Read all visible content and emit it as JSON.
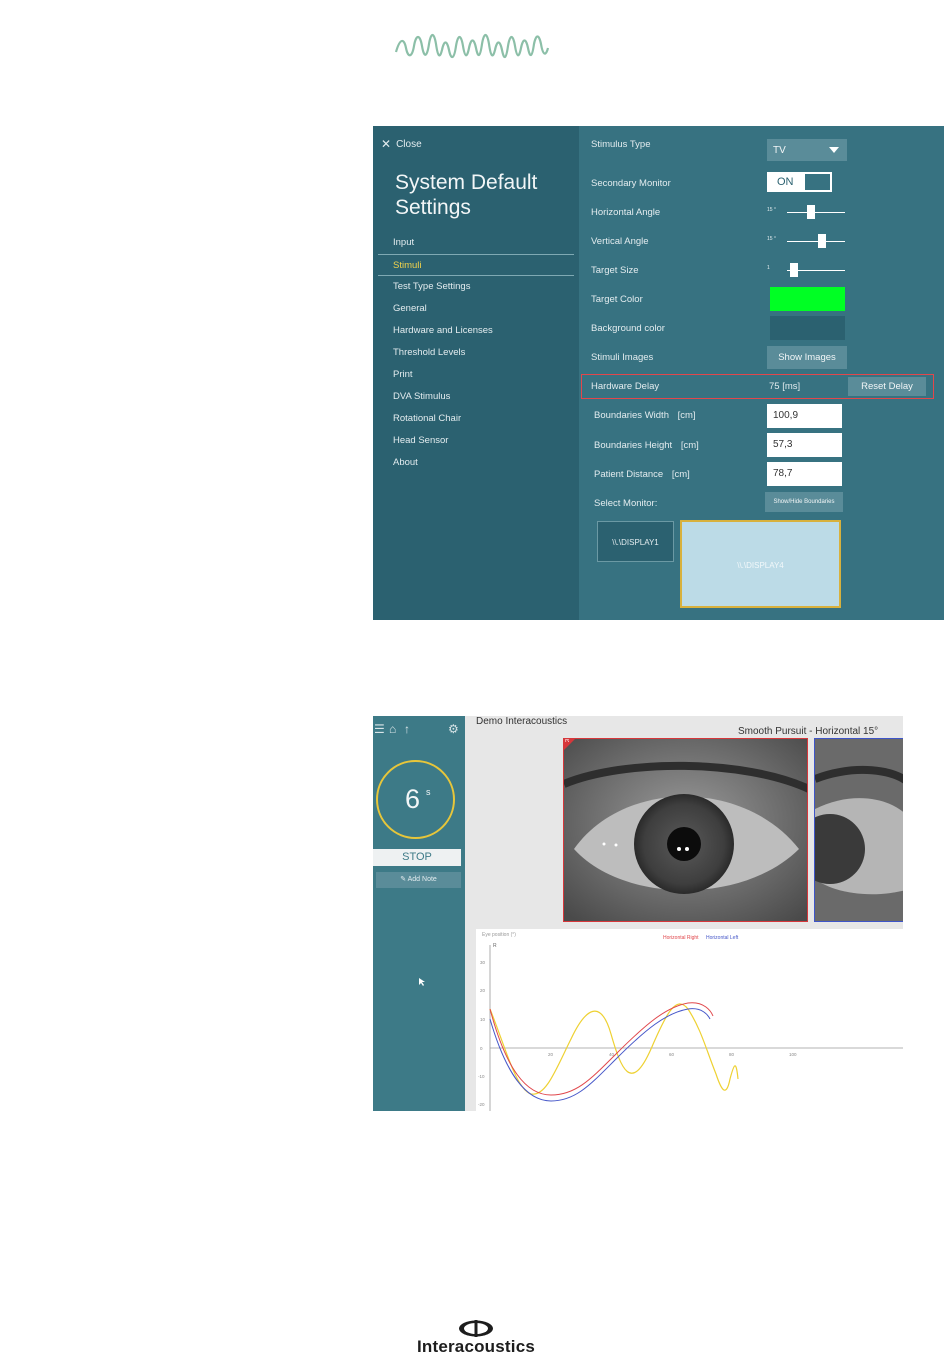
{
  "settings": {
    "close_label": "Close",
    "title": "System Default Settings",
    "nav": [
      {
        "label": "Input",
        "active": false
      },
      {
        "label": "Stimuli",
        "active": true
      },
      {
        "label": "Test Type Settings",
        "active": false
      },
      {
        "label": "General",
        "active": false
      },
      {
        "label": "Hardware and Licenses",
        "active": false
      },
      {
        "label": "Threshold Levels",
        "active": false
      },
      {
        "label": "Print",
        "active": false
      },
      {
        "label": "DVA Stimulus",
        "active": false
      },
      {
        "label": "Rotational Chair",
        "active": false
      },
      {
        "label": "Head Sensor",
        "active": false
      },
      {
        "label": "About",
        "active": false
      }
    ],
    "stimulus_type": {
      "label": "Stimulus Type",
      "value": "TV"
    },
    "secondary_monitor": {
      "label": "Secondary Monitor",
      "value": "ON"
    },
    "horizontal_angle": {
      "label": "Horizontal Angle",
      "value_label": "15 °",
      "level": 0.4
    },
    "vertical_angle": {
      "label": "Vertical Angle",
      "value_label": "15 °",
      "level": 0.62
    },
    "target_size": {
      "label": "Target Size",
      "value_label": "1",
      "level": 0.05
    },
    "target_color": {
      "label": "Target Color",
      "color": "#00ff24"
    },
    "background_color": {
      "label": "Background color",
      "color": "#2b6170"
    },
    "stimuli_images": {
      "label": "Stimuli Images",
      "button": "Show Images"
    },
    "hardware_delay": {
      "label": "Hardware Delay",
      "value": "75 [ms]",
      "button": "Reset Delay"
    },
    "boundaries_width": {
      "label": "Boundaries Width",
      "unit": "[cm]",
      "value": "100,9"
    },
    "boundaries_height": {
      "label": "Boundaries Height",
      "unit": "[cm]",
      "value": "57,3"
    },
    "patient_distance": {
      "label": "Patient Distance",
      "unit": "[cm]",
      "value": "78,7"
    },
    "select_monitor": {
      "label": "Select Monitor:",
      "button": "Show/Hide Boundaries"
    },
    "displays": [
      "\\\\.\\DISPLAY1",
      "\\\\.\\DISPLAY4"
    ],
    "colors": {
      "panel": "#377281",
      "sidebar": "#2b6170",
      "accent": "#f1d34b",
      "highlight": "#e2474b"
    }
  },
  "test_screen": {
    "patient": "Demo Interacoustics",
    "test_name": "Smooth Pursuit - Horizontal 15°",
    "timer_value": "6",
    "timer_unit": "s",
    "stop_label": "STOP",
    "add_note_label": "Add Note",
    "right_eye_flag": "R",
    "plot_title": "Eye position (°)",
    "legend": [
      {
        "label": "Horizontal Right",
        "color": "#e0474c"
      },
      {
        "label": "Horizontal Left",
        "color": "#4758c9"
      }
    ],
    "y_ticks": [
      "30",
      "20",
      "10",
      "0",
      "-10",
      "-20"
    ],
    "x_ticks": [
      "20",
      "40",
      "60",
      "80",
      "100"
    ],
    "y_axis_label": "R"
  },
  "brand_name": "Interacoustics"
}
